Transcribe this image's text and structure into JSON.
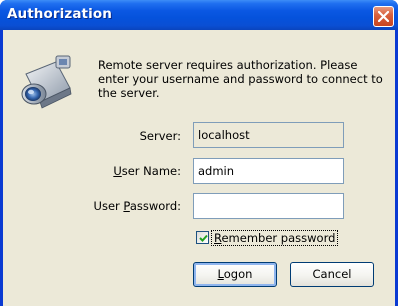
{
  "window": {
    "title": "Authorization",
    "close_symbol": "×"
  },
  "message": "Remote server requires authorization. Please enter your username and password to connect to the server.",
  "form": {
    "server": {
      "label": "Server:",
      "value": "localhost"
    },
    "username": {
      "label_mnemonic": "U",
      "label_rest": "ser Name:",
      "value": "admin"
    },
    "password": {
      "label_prefix": "User ",
      "label_mnemonic": "P",
      "label_rest": "assword:",
      "value": ""
    },
    "remember": {
      "label_mnemonic": "R",
      "label_rest": "emember password",
      "checked": true
    }
  },
  "buttons": {
    "logon": {
      "mnemonic": "L",
      "rest": "ogon"
    },
    "cancel": {
      "label": "Cancel"
    }
  },
  "icons": {
    "dialog_icon": "server-camera-icon",
    "close_icon": "close-icon",
    "check_icon": "checkmark-icon"
  },
  "colors": {
    "titlebar": "#0552dc",
    "dialog_background": "#ece9d8",
    "close_button": "#d9623f",
    "field_border": "#7f9db9"
  }
}
